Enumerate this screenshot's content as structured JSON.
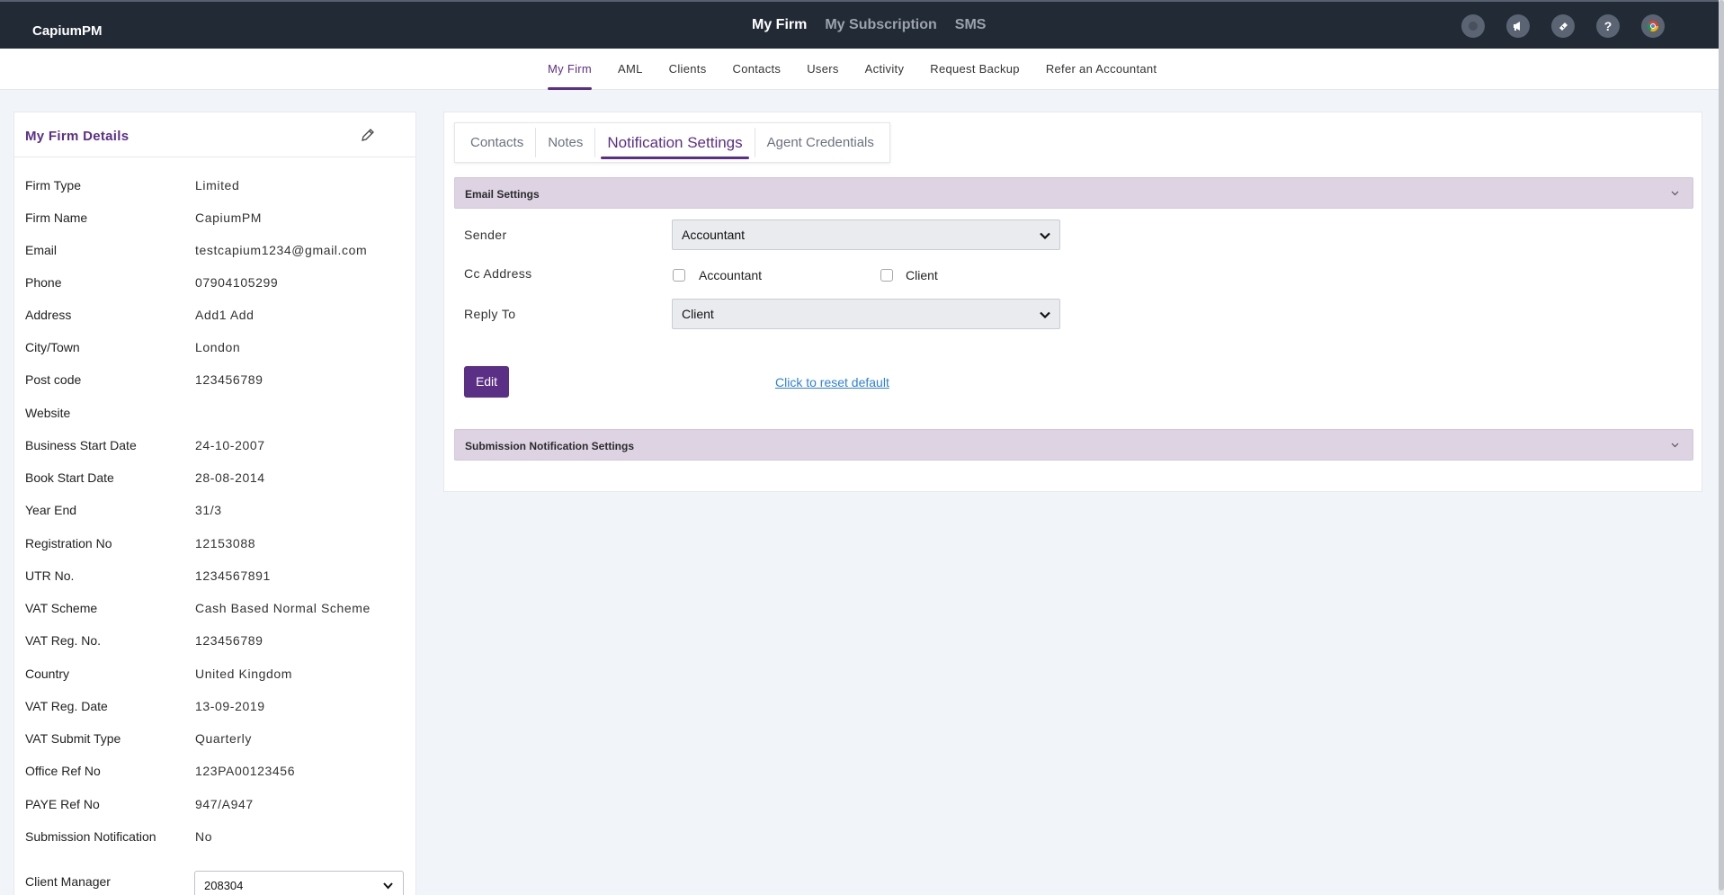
{
  "app": {
    "brand": "CapiumPM",
    "top_nav": [
      "My Firm",
      "My Subscription",
      "SMS"
    ],
    "top_nav_active": "My Firm",
    "top_icons": [
      "status-circle-icon",
      "megaphone-icon",
      "ticket-icon",
      "help-icon",
      "chrome-icon"
    ],
    "help_glyph": "?"
  },
  "sub_nav": {
    "items": [
      "My Firm",
      "AML",
      "Clients",
      "Contacts",
      "Users",
      "Activity",
      "Request Backup",
      "Refer an Accountant"
    ],
    "active": "My Firm"
  },
  "firm_details": {
    "title": "My Firm Details",
    "rows": [
      {
        "label": "Firm Type",
        "value": "Limited"
      },
      {
        "label": "Firm Name",
        "value": "CapiumPM"
      },
      {
        "label": "Email",
        "value": "testcapium1234@gmail.com"
      },
      {
        "label": "Phone",
        "value": "07904105299"
      },
      {
        "label": "Address",
        "value": "Add1 Add"
      },
      {
        "label": "City/Town",
        "value": "London"
      },
      {
        "label": "Post code",
        "value": "123456789"
      },
      {
        "label": "Website",
        "value": ""
      },
      {
        "label": "Business Start Date",
        "value": "24-10-2007"
      },
      {
        "label": "Book Start Date",
        "value": "28-08-2014"
      },
      {
        "label": "Year End",
        "value": "31/3"
      },
      {
        "label": "Registration No",
        "value": "12153088"
      },
      {
        "label": "UTR No.",
        "value": "1234567891"
      },
      {
        "label": "VAT Scheme",
        "value": "Cash Based Normal Scheme"
      },
      {
        "label": "VAT Reg. No.",
        "value": "123456789"
      },
      {
        "label": "Country",
        "value": "United Kingdom"
      },
      {
        "label": "VAT Reg. Date",
        "value": "13-09-2019"
      },
      {
        "label": "VAT Submit Type",
        "value": "Quarterly"
      },
      {
        "label": "Office Ref No",
        "value": "123PA00123456"
      },
      {
        "label": "PAYE Ref No",
        "value": "947/A947"
      },
      {
        "label": "Submission Notification",
        "value": "No"
      }
    ],
    "client_manager": {
      "label": "Client Manager",
      "value": "208304"
    }
  },
  "tabs": {
    "items": [
      "Contacts",
      "Notes",
      "Notification Settings",
      "Agent Credentials"
    ],
    "active": "Notification Settings"
  },
  "email_settings": {
    "title": "Email Settings",
    "sender": {
      "label": "Sender",
      "value": "Accountant"
    },
    "cc": {
      "label": "Cc Address",
      "options": [
        {
          "label": "Accountant",
          "checked": false
        },
        {
          "label": "Client",
          "checked": false
        }
      ]
    },
    "reply_to": {
      "label": "Reply To",
      "value": "Client"
    },
    "edit_label": "Edit",
    "reset_label": "Click to reset default"
  },
  "submission_settings": {
    "title": "Submission Notification Settings"
  },
  "colors": {
    "accent": "#5b2f86",
    "topbar": "#222a36",
    "section_bg": "#ddd3e3",
    "link": "#2f80d6"
  }
}
